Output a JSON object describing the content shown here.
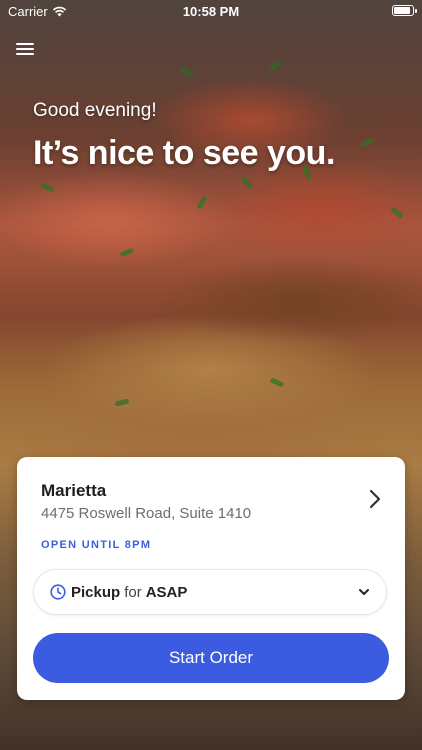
{
  "status_bar": {
    "carrier": "Carrier",
    "time": "10:58 PM"
  },
  "hero": {
    "greeting": "Good evening!",
    "headline": "It’s nice to see you."
  },
  "location": {
    "name": "Marietta",
    "address": "4475 Roswell Road, Suite 1410",
    "hours": "OPEN UNTIL 8PM"
  },
  "order_mode": {
    "mode": "Pickup",
    "connector": "for",
    "time": "ASAP"
  },
  "actions": {
    "start_order": "Start Order"
  },
  "colors": {
    "accent": "#3b5be0",
    "hours_text": "#3a5fe0"
  },
  "icons": [
    "wifi-icon",
    "battery-icon",
    "menu-icon",
    "chevron-right-icon",
    "clock-icon",
    "chevron-down-icon"
  ]
}
